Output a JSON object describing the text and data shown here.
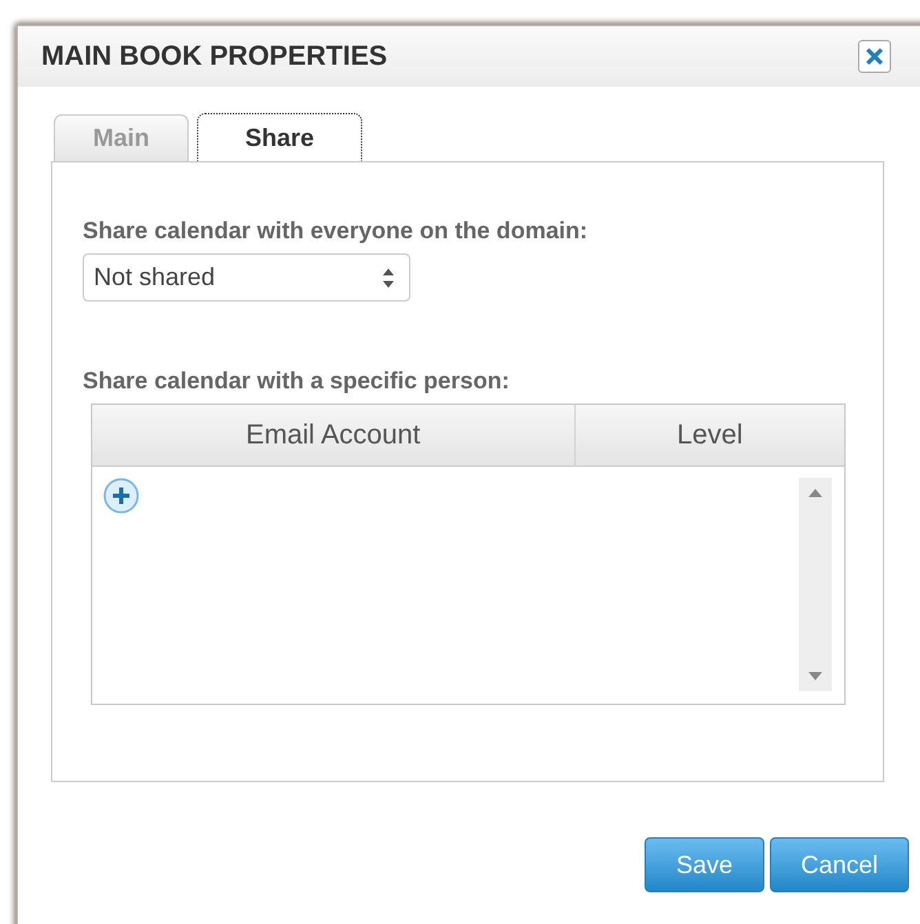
{
  "window": {
    "title": "MAIN BOOK PROPERTIES"
  },
  "tabs": [
    {
      "label": "Main",
      "selected": false
    },
    {
      "label": "Share",
      "selected": true
    }
  ],
  "domain_share": {
    "label": "Share calendar with everyone on the domain:",
    "value": "Not shared"
  },
  "person_share": {
    "label": "Share calendar with a specific person:",
    "columns": [
      "Email Account",
      "Level"
    ]
  },
  "buttons": [
    "Save",
    "Cancel"
  ]
}
